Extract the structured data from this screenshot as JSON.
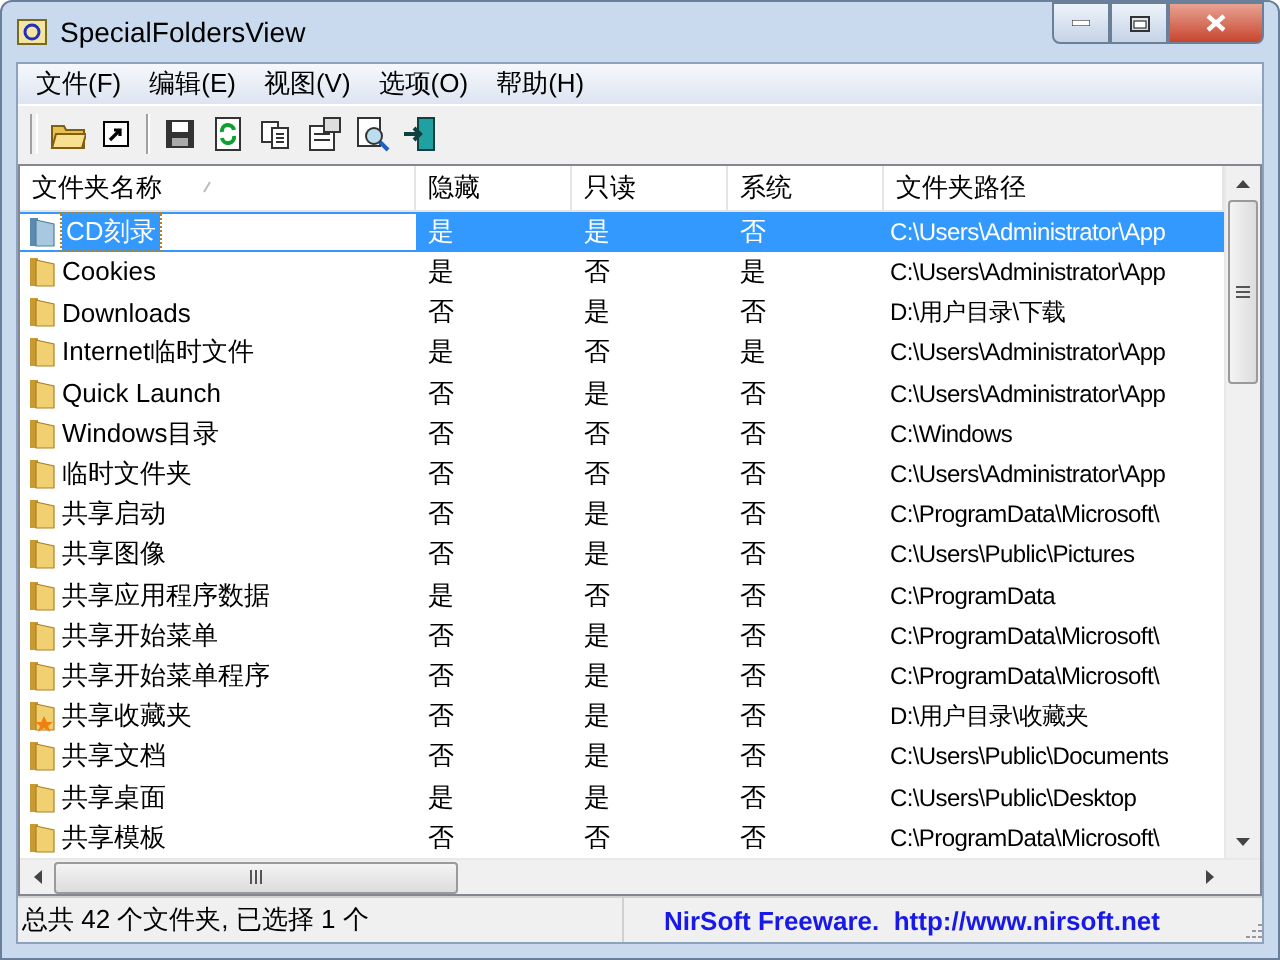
{
  "window": {
    "title": "SpecialFoldersView"
  },
  "menu": [
    {
      "label": "文件(F)"
    },
    {
      "label": "编辑(E)"
    },
    {
      "label": "视图(V)"
    },
    {
      "label": "选项(O)"
    },
    {
      "label": "帮助(H)"
    }
  ],
  "toolbar": [
    {
      "kind": "folder"
    },
    {
      "kind": "shortcut"
    },
    {
      "kind": "separator"
    },
    {
      "kind": "save"
    },
    {
      "kind": "refresh"
    },
    {
      "kind": "copy"
    },
    {
      "kind": "properties"
    },
    {
      "kind": "search"
    },
    {
      "kind": "exit"
    }
  ],
  "table": {
    "columns": [
      "文件夹名称",
      "隐藏",
      "只读",
      "系统",
      "文件夹路径"
    ],
    "rows": [
      {
        "kind": "cd",
        "selected": true,
        "cells": [
          "CD刻录",
          "是",
          "是",
          "否",
          "C:\\Users\\Administrator\\App"
        ]
      },
      {
        "kind": "folder",
        "selected": false,
        "cells": [
          "Cookies",
          "是",
          "否",
          "是",
          "C:\\Users\\Administrator\\App"
        ]
      },
      {
        "kind": "folder",
        "selected": false,
        "cells": [
          "Downloads",
          "否",
          "是",
          "否",
          "D:\\用户目录\\下载"
        ]
      },
      {
        "kind": "folder",
        "selected": false,
        "cells": [
          "Internet临时文件",
          "是",
          "否",
          "是",
          "C:\\Users\\Administrator\\App"
        ]
      },
      {
        "kind": "folder",
        "selected": false,
        "cells": [
          "Quick Launch",
          "否",
          "是",
          "否",
          "C:\\Users\\Administrator\\App"
        ]
      },
      {
        "kind": "folder",
        "selected": false,
        "cells": [
          "Windows目录",
          "否",
          "否",
          "否",
          "C:\\Windows"
        ]
      },
      {
        "kind": "folder",
        "selected": false,
        "cells": [
          "临时文件夹",
          "否",
          "否",
          "否",
          "C:\\Users\\Administrator\\App"
        ]
      },
      {
        "kind": "folder",
        "selected": false,
        "cells": [
          "共享启动",
          "否",
          "是",
          "否",
          "C:\\ProgramData\\Microsoft\\"
        ]
      },
      {
        "kind": "folder",
        "selected": false,
        "cells": [
          "共享图像",
          "否",
          "是",
          "否",
          "C:\\Users\\Public\\Pictures"
        ]
      },
      {
        "kind": "folder",
        "selected": false,
        "cells": [
          "共享应用程序数据",
          "是",
          "否",
          "否",
          "C:\\ProgramData"
        ]
      },
      {
        "kind": "folder",
        "selected": false,
        "cells": [
          "共享开始菜单",
          "否",
          "是",
          "否",
          "C:\\ProgramData\\Microsoft\\"
        ]
      },
      {
        "kind": "folder",
        "selected": false,
        "cells": [
          "共享开始菜单程序",
          "否",
          "是",
          "否",
          "C:\\ProgramData\\Microsoft\\"
        ]
      },
      {
        "kind": "favorites",
        "selected": false,
        "cells": [
          "共享收藏夹",
          "否",
          "是",
          "否",
          "D:\\用户目录\\收藏夹"
        ]
      },
      {
        "kind": "folder",
        "selected": false,
        "cells": [
          "共享文档",
          "否",
          "是",
          "否",
          "C:\\Users\\Public\\Documents"
        ]
      },
      {
        "kind": "folder",
        "selected": false,
        "cells": [
          "共享桌面",
          "是",
          "是",
          "否",
          "C:\\Users\\Public\\Desktop"
        ]
      },
      {
        "kind": "folder",
        "selected": false,
        "cells": [
          "共享模板",
          "否",
          "否",
          "否",
          "C:\\ProgramData\\Microsoft\\"
        ]
      }
    ]
  },
  "status_bar": {
    "summary": "总共 42 个文件夹, 已选择 1 个",
    "credit": "NirSoft Freeware.  http://www.nirsoft.net"
  }
}
